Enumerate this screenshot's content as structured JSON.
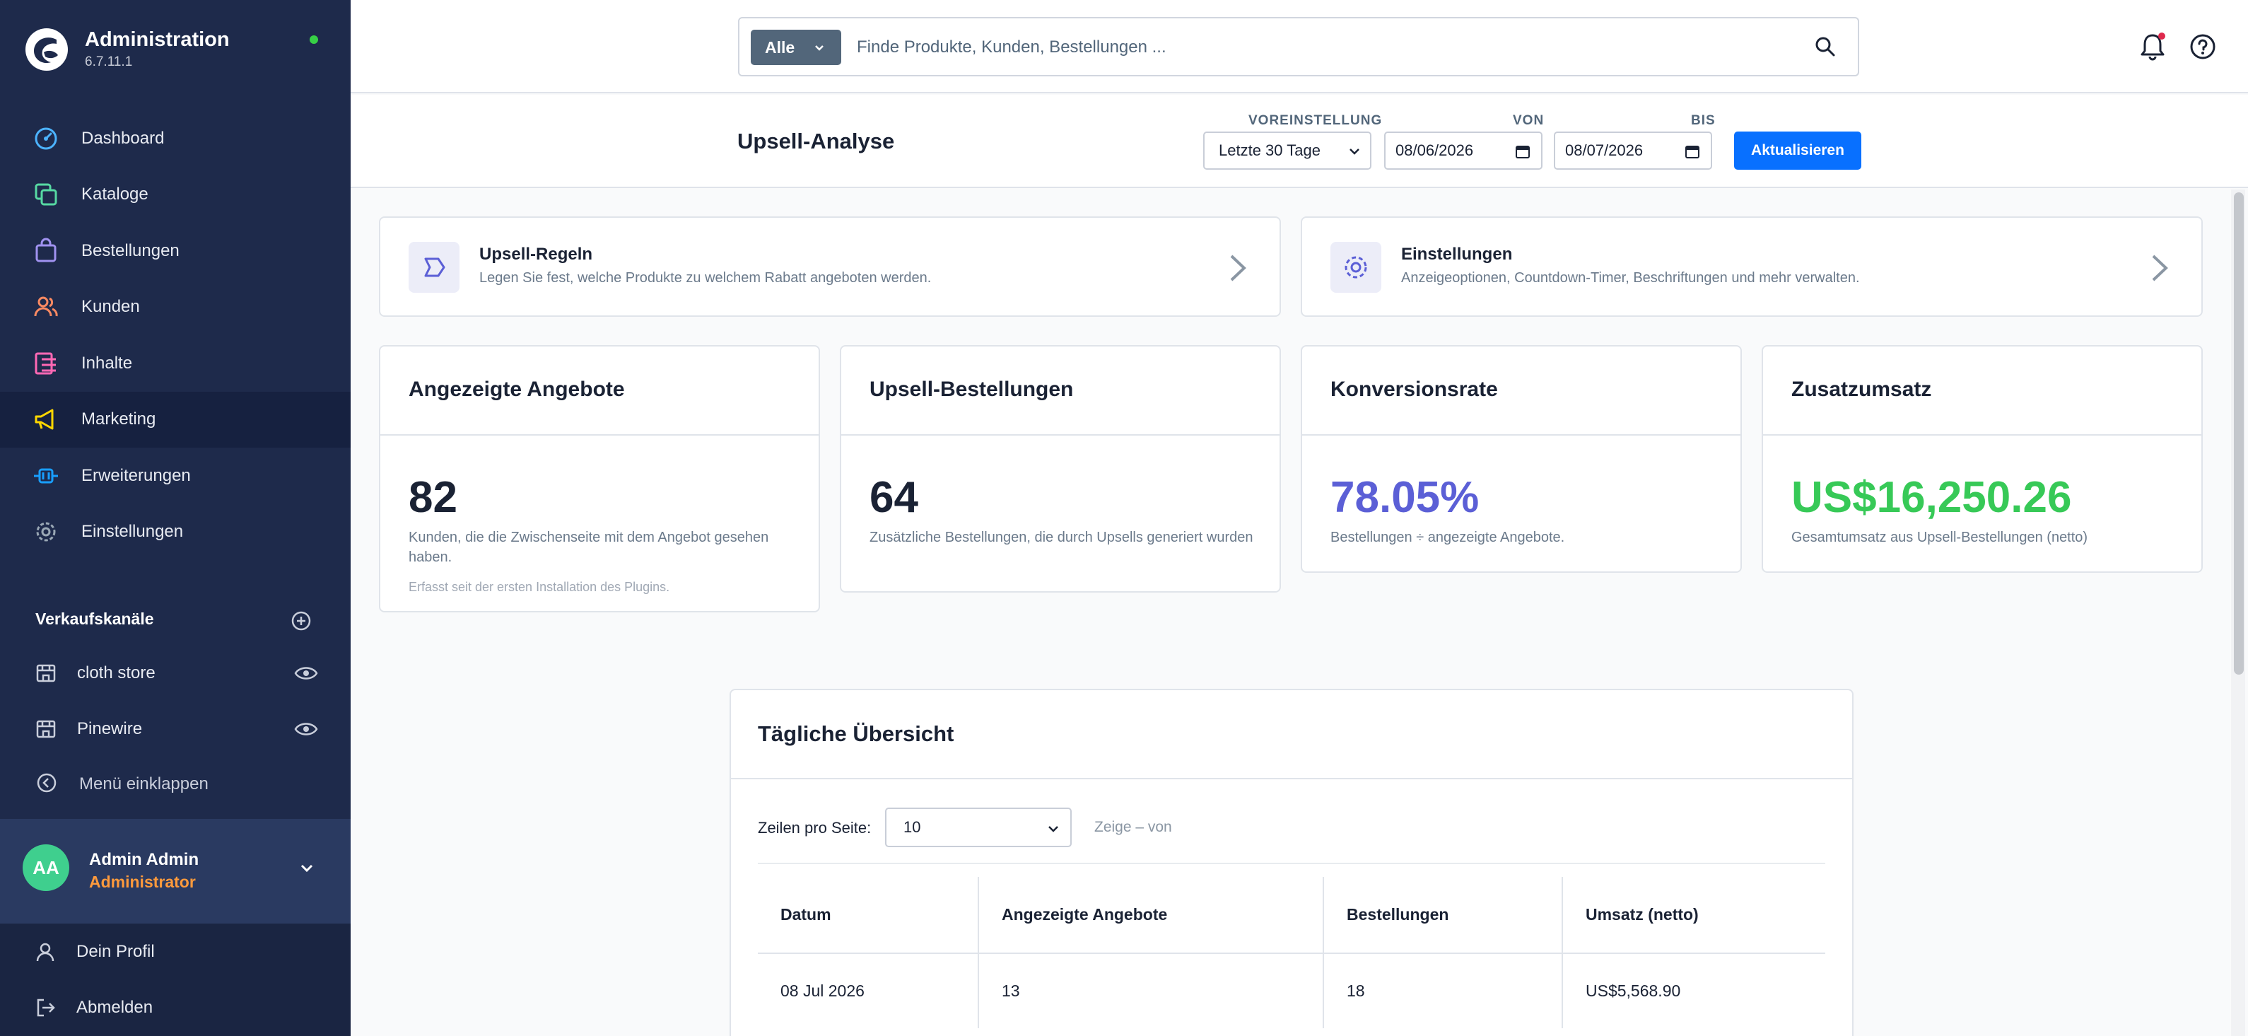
{
  "sidebar": {
    "brand_title": "Administration",
    "brand_version": "6.7.11.1",
    "nav": [
      {
        "label": "Dashboard",
        "icon": "gauge-icon",
        "color": "#4cb3ff"
      },
      {
        "label": "Kataloge",
        "icon": "catalog-icon",
        "color": "#57d9a3"
      },
      {
        "label": "Bestellungen",
        "icon": "shopping-bag-icon",
        "color": "#a092f0"
      },
      {
        "label": "Kunden",
        "icon": "users-icon",
        "color": "#f88962"
      },
      {
        "label": "Inhalte",
        "icon": "content-icon",
        "color": "#ff68b4"
      },
      {
        "label": "Marketing",
        "icon": "megaphone-icon",
        "color": "#ffd700"
      },
      {
        "label": "Erweiterungen",
        "icon": "plug-icon",
        "color": "#189eff"
      },
      {
        "label": "Einstellungen",
        "icon": "gear-icon",
        "color": "#9aa8b5"
      }
    ],
    "channels_title": "Verkaufskanäle",
    "channels": [
      {
        "label": "cloth store"
      },
      {
        "label": "Pinewire"
      }
    ],
    "collapse_label": "Menü einklappen",
    "user": {
      "initials": "AA",
      "name": "Admin Admin",
      "role": "Administrator"
    },
    "profile_label": "Dein Profil",
    "logout_label": "Abmelden"
  },
  "topbar": {
    "search_type": "Alle",
    "search_placeholder": "Finde Produkte, Kunden, Bestellungen ..."
  },
  "header": {
    "title": "Upsell-Analyse",
    "preset_label": "VOREINSTELLUNG",
    "preset_value": "Letzte 30 Tage",
    "from_label": "VON",
    "from_value": "08/06/2026",
    "to_label": "BIS",
    "to_value": "08/07/2026",
    "refresh_label": "Aktualisieren"
  },
  "link_cards": [
    {
      "title": "Upsell-Regeln",
      "desc": "Legen Sie fest, welche Produkte zu welchem Rabatt angeboten werden."
    },
    {
      "title": "Einstellungen",
      "desc": "Anzeigeoptionen, Countdown-Timer, Beschriftungen und mehr verwalten."
    }
  ],
  "stats": [
    {
      "title": "Angezeigte Angebote",
      "value": "82",
      "desc": "Kunden, die die Zwischenseite mit dem Angebot gesehen haben.",
      "note": "Erfasst seit der ersten Installation des Plugins.",
      "color": "#1a2234"
    },
    {
      "title": "Upsell-Bestellungen",
      "value": "64",
      "desc": "Zusätzliche Bestellungen, die durch Upsells generiert wurden",
      "color": "#1a2234"
    },
    {
      "title": "Konversionsrate",
      "value": "78.05%",
      "desc": "Bestellungen ÷ angezeigte Angebote.",
      "color": "#5b5fd6"
    },
    {
      "title": "Zusatzumsatz",
      "value": "US$16,250.26",
      "desc": "Gesamtumsatz aus Upsell-Bestellungen (netto)",
      "color": "#37c957"
    }
  ],
  "daily": {
    "title": "Tägliche Übersicht",
    "rows_label": "Zeilen pro Seite:",
    "rows_value": "10",
    "rows_info": "Zeige – von",
    "columns": [
      "Datum",
      "Angezeigte Angebote",
      "Bestellungen",
      "Umsatz (netto)"
    ],
    "rows": [
      [
        "08 Jul 2026",
        "13",
        "18",
        "US$5,568.90"
      ]
    ]
  }
}
